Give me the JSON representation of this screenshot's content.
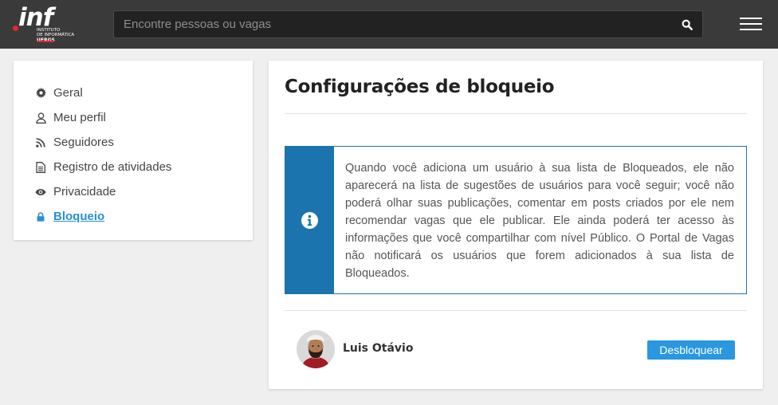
{
  "header": {
    "logo": {
      "mark": "inf",
      "line1": "INSTITUTO",
      "line2": "DE INFORMÁTICA",
      "line3": "UFRGS"
    },
    "search": {
      "placeholder": "Encontre pessoas ou vagas",
      "value": "",
      "icon": "search-icon"
    },
    "menu_icon": "hamburger-menu-icon"
  },
  "sidebar": {
    "items": [
      {
        "label": "Geral",
        "icon": "gear-icon",
        "active": false
      },
      {
        "label": "Meu perfil",
        "icon": "user-icon",
        "active": false
      },
      {
        "label": "Seguidores",
        "icon": "rss-icon",
        "active": false
      },
      {
        "label": "Registro de atividades",
        "icon": "document-icon",
        "active": false
      },
      {
        "label": "Privacidade",
        "icon": "eye-icon",
        "active": false
      },
      {
        "label": "Bloqueio",
        "icon": "lock-icon",
        "active": true
      }
    ]
  },
  "main": {
    "title": "Configurações de bloqueio",
    "info": {
      "icon": "info-icon",
      "text": "Quando você adiciona um usuário à sua lista de Bloqueados, ele não aparecerá na lista de sugestões de usuários para você seguir; você não poderá olhar suas publicações, comentar em posts criados por ele nem recomendar vagas que ele publicar. Ele ainda poderá ter acesso às informações que você compartilhar com nível Público. O Portal de Vagas não notificará os usuários que forem adicionados à sua lista de Bloqueados."
    },
    "blocked_users": [
      {
        "name": "Luis Otávio",
        "button_label": "Desbloquear"
      }
    ]
  },
  "colors": {
    "topbar": "#3a3a3a",
    "accent": "#1b74ad",
    "link": "#2a8fd1",
    "button": "#2a97e0",
    "logo_red": "#e3262f"
  }
}
